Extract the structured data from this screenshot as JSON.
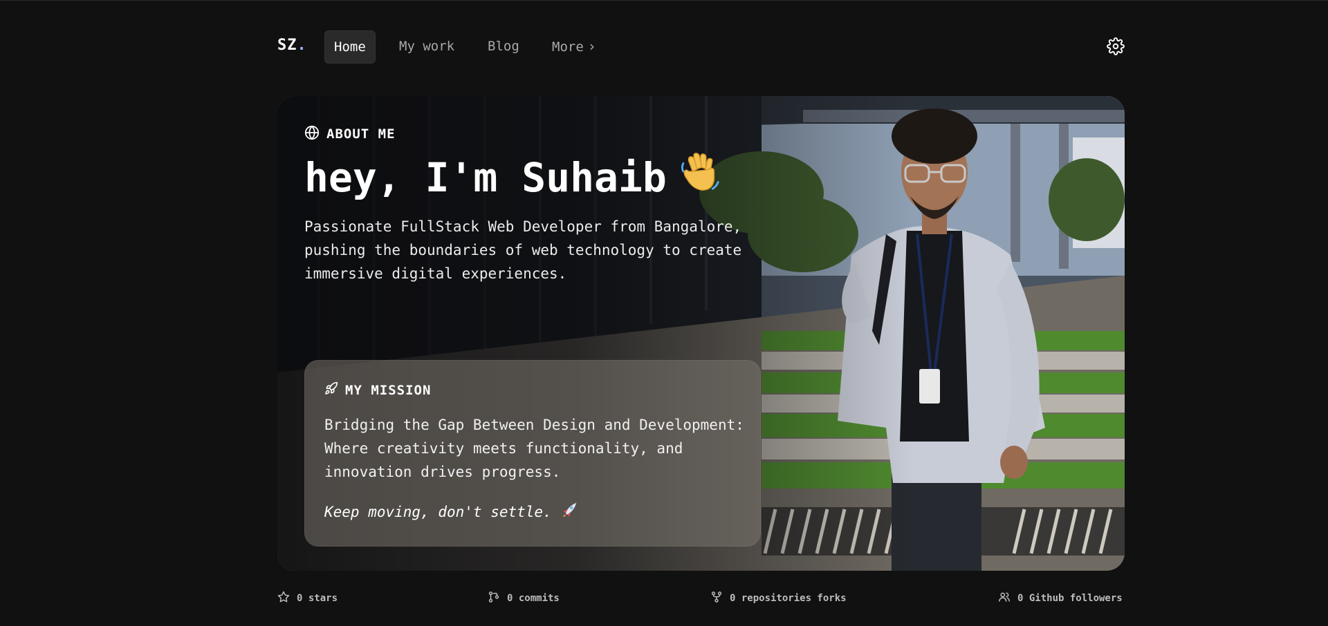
{
  "nav": {
    "logo": "SZ",
    "logo_dot": ".",
    "items": [
      {
        "label": "Home",
        "active": true
      },
      {
        "label": "My work"
      },
      {
        "label": "Blog"
      },
      {
        "label": "More"
      }
    ],
    "settings_icon": "gear-icon"
  },
  "hero": {
    "about_label": "ABOUT ME",
    "headline": "hey, I'm Suhaib",
    "intro": "Passionate FullStack Web Developer from Bangalore, pushing the boundaries of web technology to create immersive digital experiences.",
    "mission": {
      "label": "MY MISSION",
      "text": "Bridging the Gap Between Design and Development: Where creativity meets functionality, and innovation drives progress.",
      "motto": "Keep moving, don't settle."
    }
  },
  "stats": {
    "stars": "0 stars",
    "commits": "0 commits",
    "forks": "0 repositories forks",
    "followers": "0 Github followers"
  },
  "colors": {
    "background": "#111111",
    "accent_dot": "#9db4ff",
    "mission_card": "#78736c"
  }
}
